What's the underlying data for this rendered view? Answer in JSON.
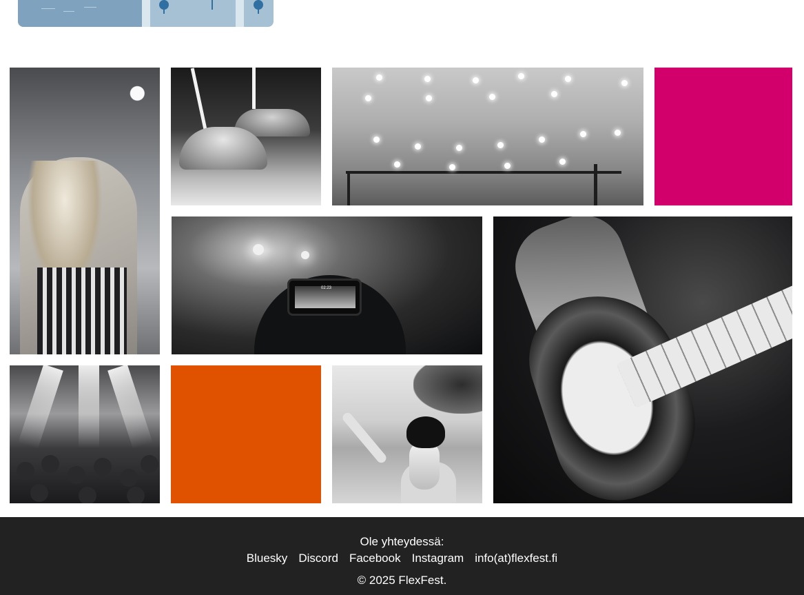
{
  "gallery": {
    "tiles": [
      {
        "name": "singer-photo",
        "color": "grayscale"
      },
      {
        "name": "burgers-photo",
        "color": "grayscale"
      },
      {
        "name": "string-lights-photo",
        "color": "grayscale"
      },
      {
        "name": "magenta-block",
        "color": "#d1006b"
      },
      {
        "name": "phone-recording-photo",
        "color": "grayscale"
      },
      {
        "name": "guitarist-photo",
        "color": "grayscale"
      },
      {
        "name": "concert-crowd-photo",
        "color": "grayscale"
      },
      {
        "name": "orange-block",
        "color": "#e05100"
      },
      {
        "name": "festival-girl-photo",
        "color": "grayscale"
      }
    ],
    "phone_screen_time": "02:23"
  },
  "footer": {
    "contact_title": "Ole yhteydessä:",
    "links": [
      "Bluesky",
      "Discord",
      "Facebook",
      "Instagram",
      "info(at)flexfest.fi"
    ],
    "copyright": "© 2025 FlexFest."
  },
  "colors": {
    "footer_bg": "#222222",
    "accent_magenta": "#d1006b",
    "accent_orange": "#e05100",
    "map_blue": "#a6c0d4"
  }
}
